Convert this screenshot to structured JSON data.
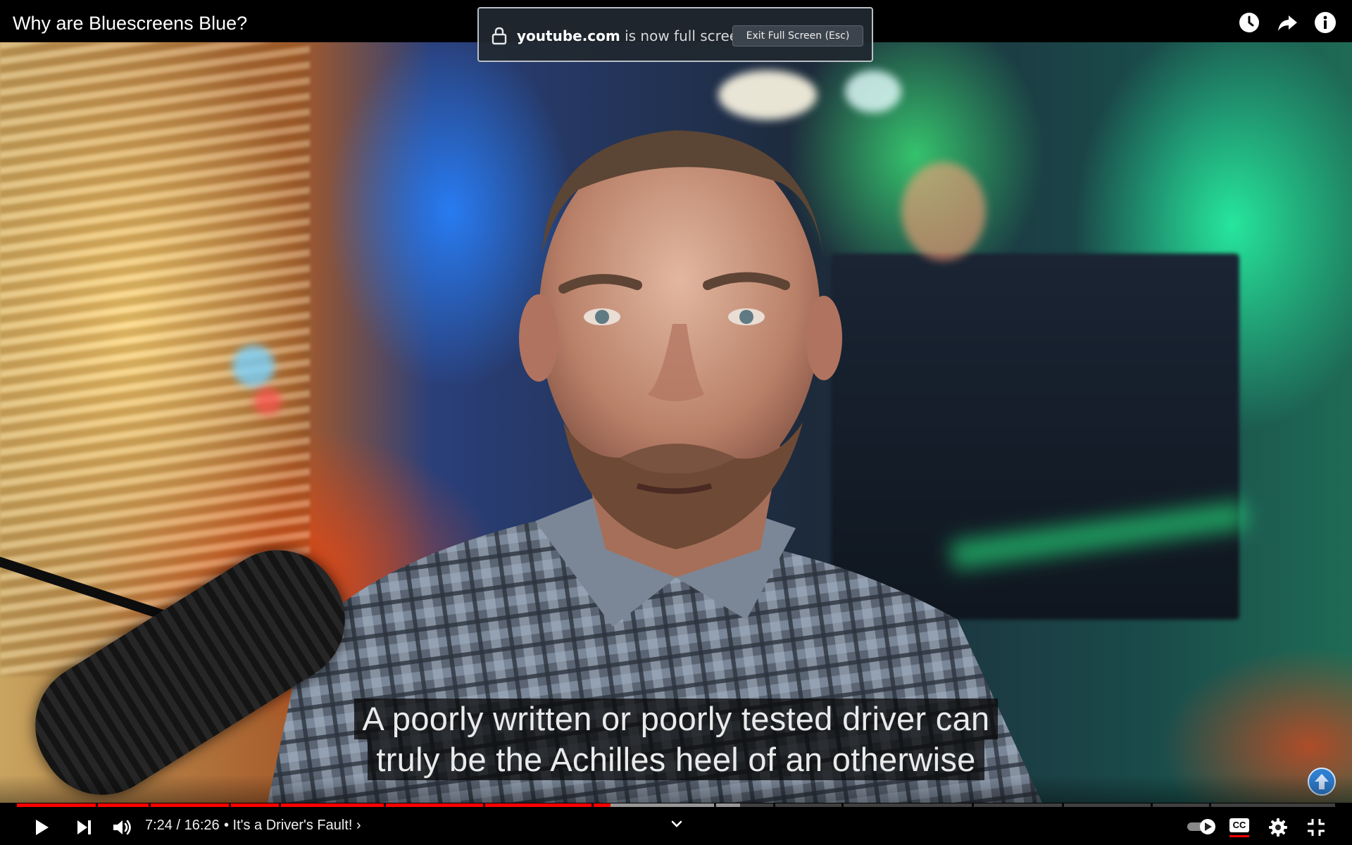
{
  "video": {
    "title": "Why are Bluescreens Blue?"
  },
  "fullscreen_notice": {
    "domain": "youtube.com",
    "message": " is now full screen",
    "exit_button": "Exit Full Screen (Esc)"
  },
  "captions": {
    "line1": "A poorly written or poorly tested driver can",
    "line2": "truly be the Achilles heel of an otherwise"
  },
  "controls": {
    "time": "7:24 / 16:26",
    "chapter": "• It's a Driver's Fault! ›",
    "progress": {
      "played_fraction": 0.4504,
      "buffered_fraction": 0.5488,
      "chapter_breaks": [
        0.0596,
        0.1001,
        0.1609,
        0.1987,
        0.2782,
        0.3537,
        0.4358,
        0.5286,
        0.5739,
        0.6253,
        0.7243,
        0.7928,
        0.8603,
        0.9044
      ]
    },
    "autoplay_on": true,
    "captions_on": true,
    "cc_label": "CC"
  },
  "icons": {
    "top": [
      "watch-later-icon",
      "share-icon",
      "info-icon"
    ],
    "bottom": [
      "play-icon",
      "next-icon",
      "volume-icon",
      "chevron-down-icon",
      "autoplay-toggle",
      "cc-icon",
      "settings-icon",
      "exit-fullscreen-icon"
    ]
  },
  "colors": {
    "progress_played": "#ff0000",
    "notice_bg": "#212830",
    "scroll_button": "#2f7fd1"
  }
}
